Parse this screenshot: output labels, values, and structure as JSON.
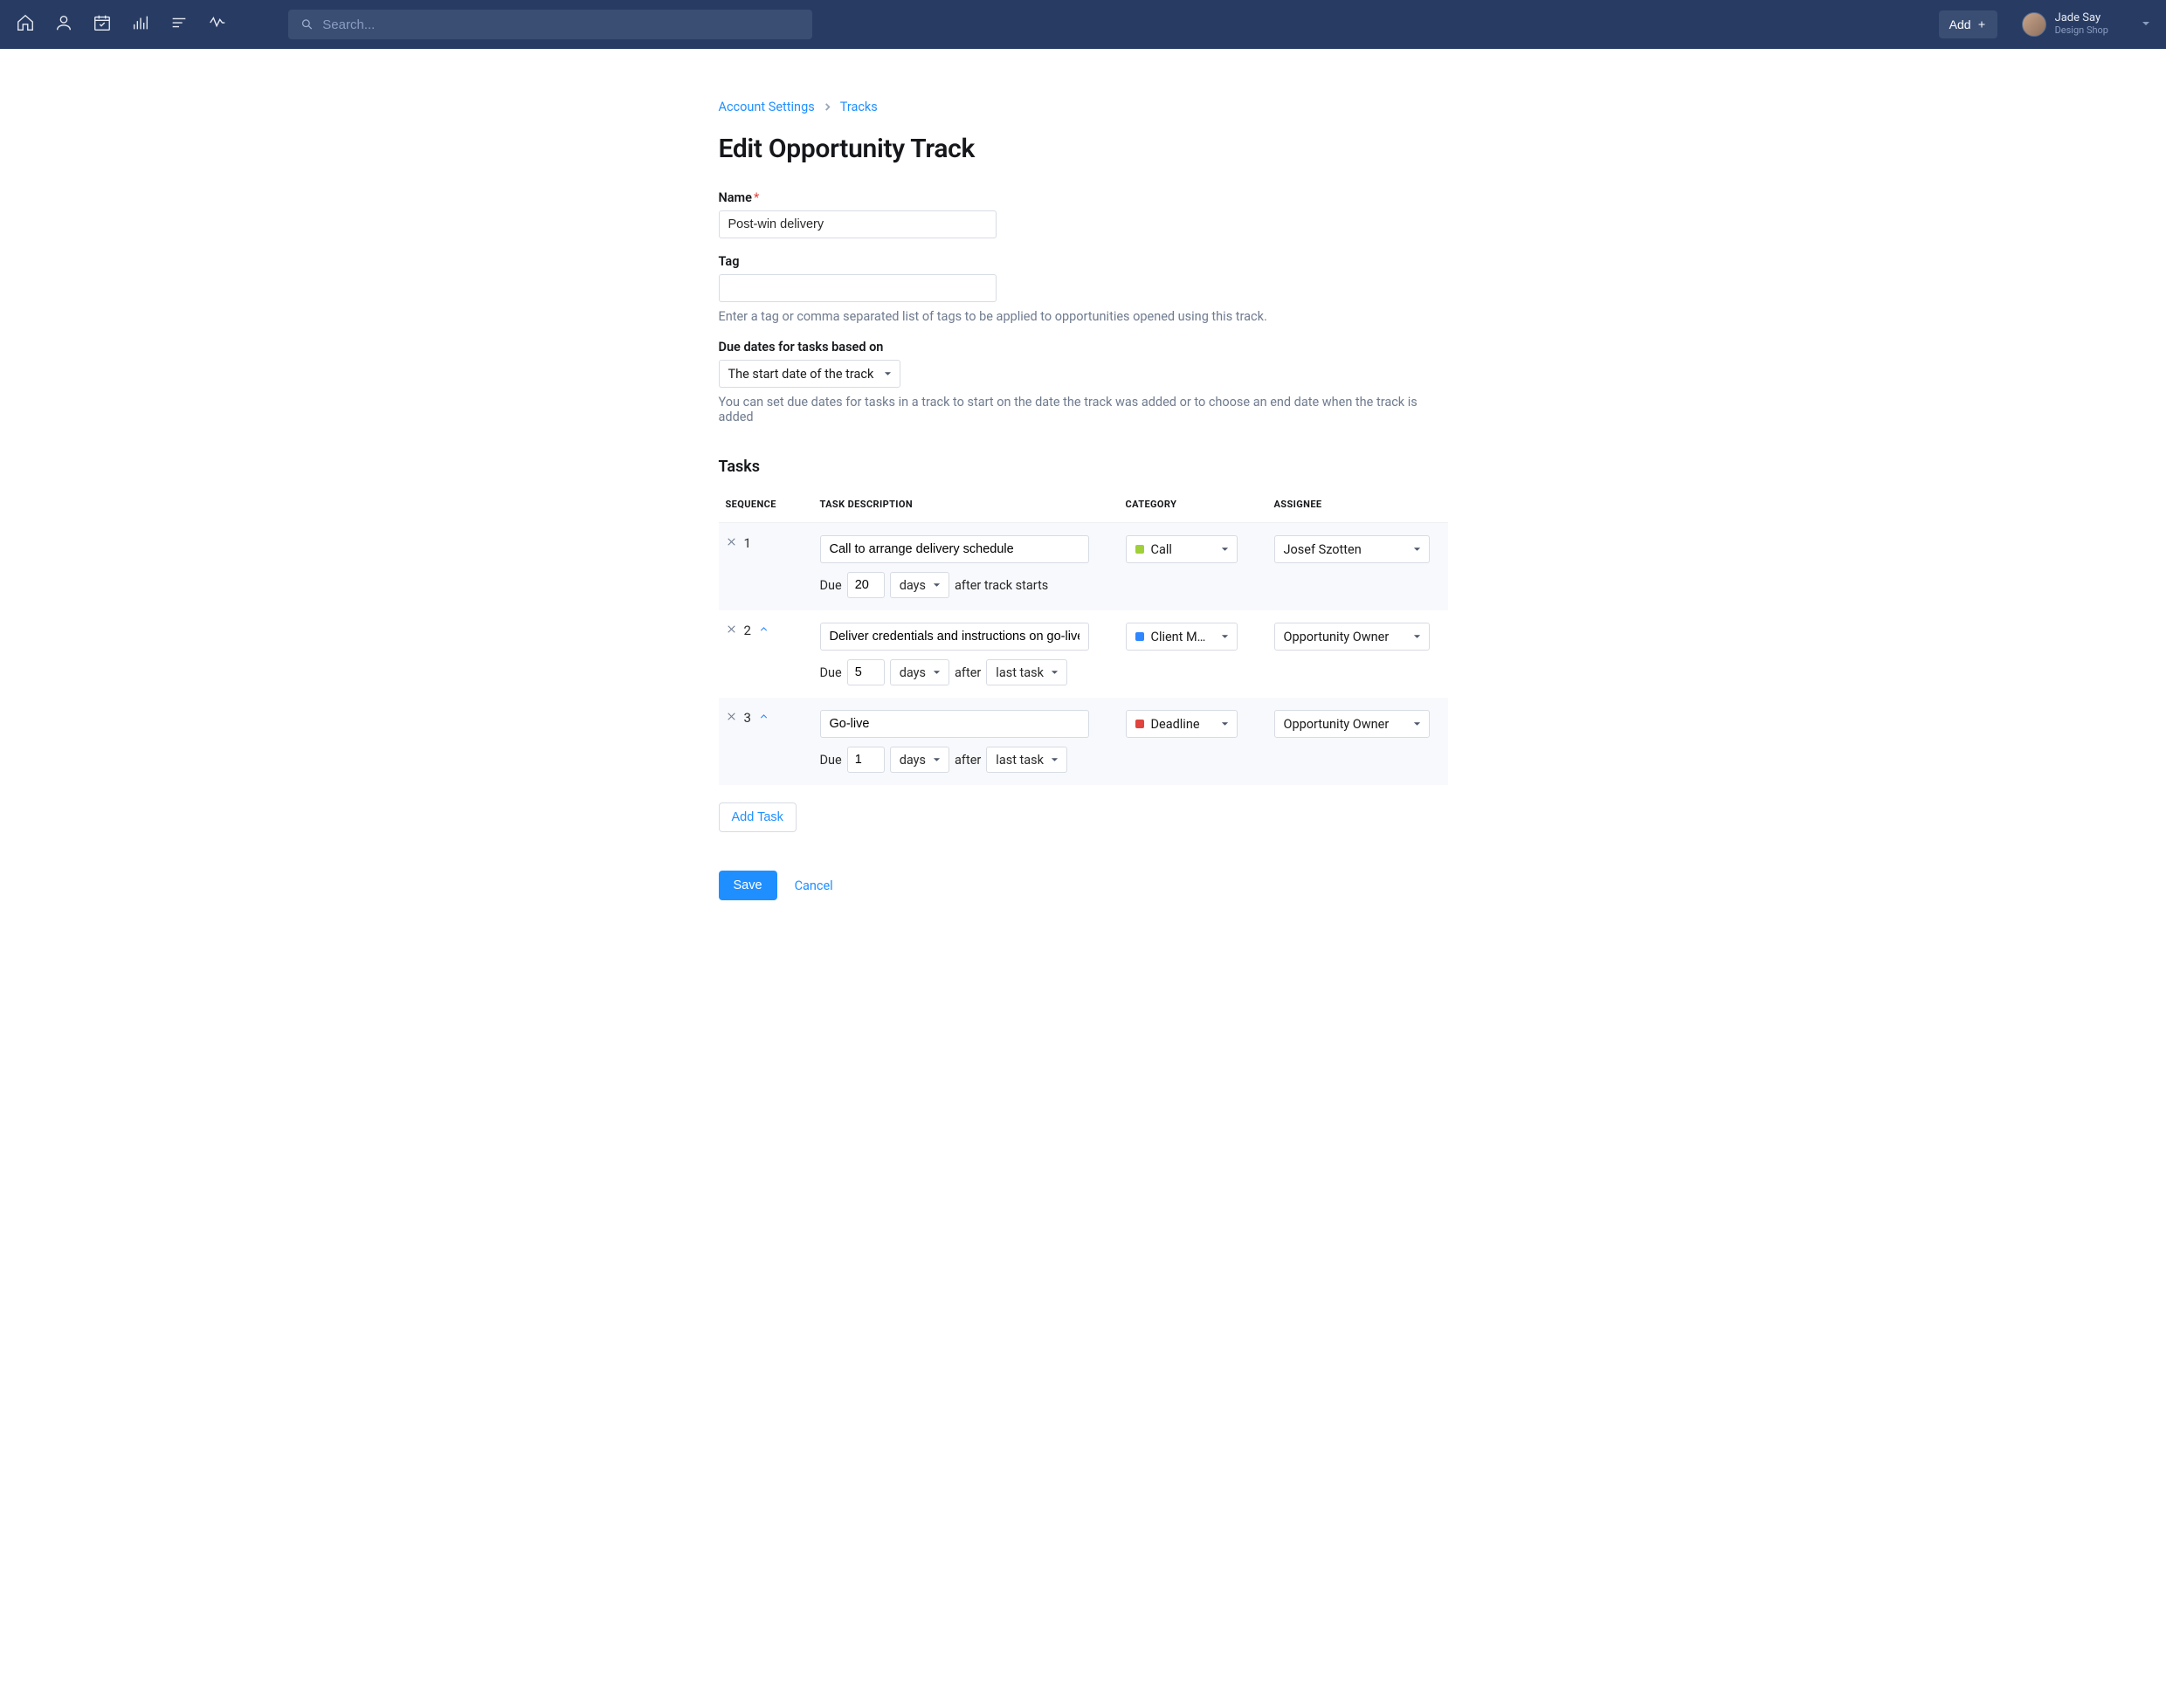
{
  "topbar": {
    "search_placeholder": "Search...",
    "add_label": "Add",
    "user_name": "Jade Say",
    "user_sub": "Design Shop"
  },
  "breadcrumb": {
    "account_settings": "Account Settings",
    "tracks": "Tracks"
  },
  "page_title": "Edit Opportunity Track",
  "form": {
    "name_label": "Name",
    "name_value": "Post-win delivery",
    "tag_label": "Tag",
    "tag_value": "",
    "tag_help": "Enter a tag or comma separated list of tags to be applied to opportunities opened using this track.",
    "due_basis_label": "Due dates for tasks based on",
    "due_basis_value": "The start date of the track",
    "due_basis_help": "You can set due dates for tasks in a track to start on the date the track was added or to choose an end date when the track is added"
  },
  "tasks": {
    "heading": "Tasks",
    "cols": {
      "sequence": "SEQUENCE",
      "description": "TASK DESCRIPTION",
      "category": "CATEGORY",
      "assignee": "ASSIGNEE"
    },
    "rows": [
      {
        "seq": "1",
        "desc": "Call to arrange delivery schedule",
        "due_label": "Due",
        "due_value": "20",
        "due_unit": "days",
        "due_suffix": "after track starts",
        "due_ref": "",
        "category": "Call",
        "cat_color": "#9fd039",
        "assignee": "Josef Szotten"
      },
      {
        "seq": "2",
        "desc": "Deliver credentials and instructions on go-live",
        "due_label": "Due",
        "due_value": "5",
        "due_unit": "days",
        "due_suffix": "after",
        "due_ref": "last task",
        "category": "Client M…",
        "cat_color": "#2f87ff",
        "assignee": "Opportunity Owner"
      },
      {
        "seq": "3",
        "desc": "Go-live",
        "due_label": "Due",
        "due_value": "1",
        "due_unit": "days",
        "due_suffix": "after",
        "due_ref": "last task",
        "category": "Deadline",
        "cat_color": "#e0443e",
        "assignee": "Opportunity Owner"
      }
    ],
    "add_task_label": "Add Task"
  },
  "actions": {
    "save": "Save",
    "cancel": "Cancel"
  }
}
